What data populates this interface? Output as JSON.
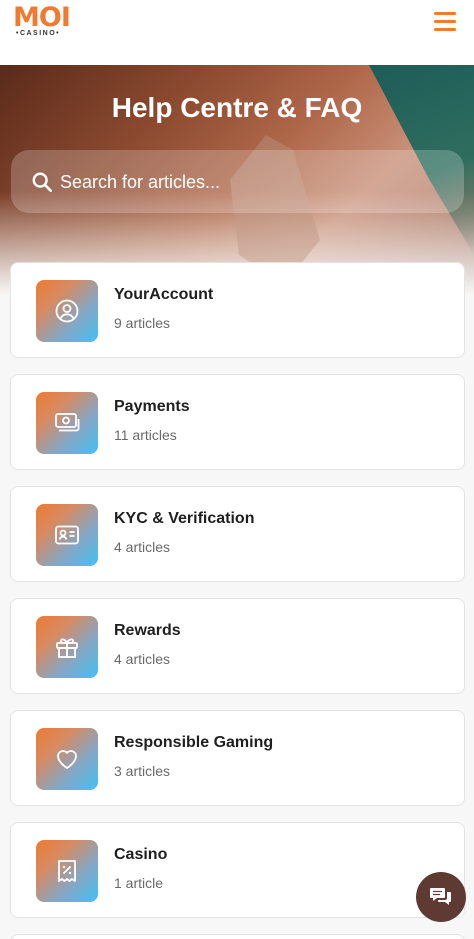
{
  "header": {
    "logo_text": "MOI",
    "logo_subtext": "•CASINO•",
    "menu_icon": "hamburger-menu-icon",
    "accent_color": "#f07a32"
  },
  "hero": {
    "title": "Help Centre & FAQ",
    "search": {
      "placeholder": "Search for articles...",
      "icon": "search-icon"
    }
  },
  "categories": [
    {
      "title": "YourAccount",
      "count": "9 articles",
      "icon": "user-circle-icon"
    },
    {
      "title": "Payments",
      "count": "11 articles",
      "icon": "cash-icon"
    },
    {
      "title": "KYC & Verification",
      "count": "4 articles",
      "icon": "id-card-icon"
    },
    {
      "title": "Rewards",
      "count": "4 articles",
      "icon": "gift-icon"
    },
    {
      "title": "Responsible Gaming",
      "count": "3 articles",
      "icon": "heart-icon"
    },
    {
      "title": "Casino",
      "count": "1 article",
      "icon": "receipt-percent-icon"
    }
  ],
  "chat": {
    "icon": "chat-bubbles-icon",
    "color": "#5e3a32"
  }
}
